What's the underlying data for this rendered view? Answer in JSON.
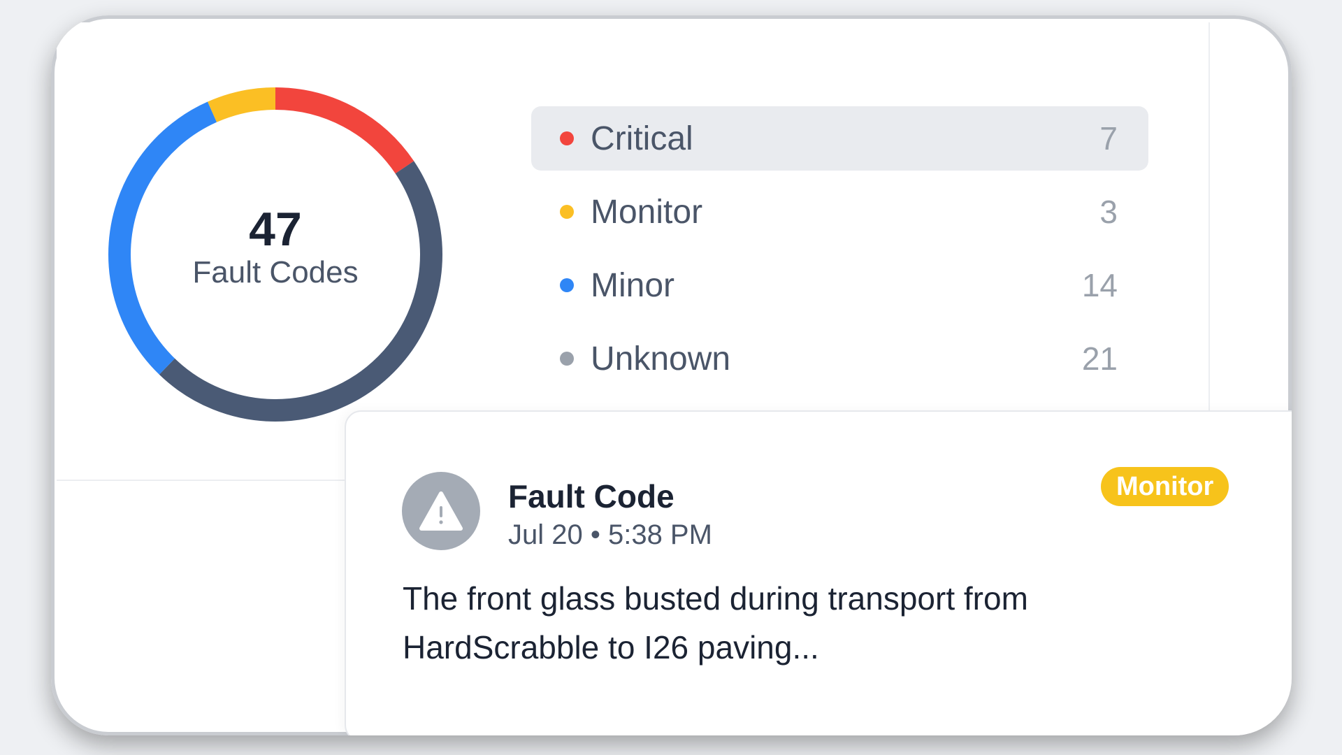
{
  "summary": {
    "total": "47",
    "total_label": "Fault Codes",
    "categories": [
      {
        "label": "Critical",
        "count": "7",
        "color": "#f2453d",
        "active": true
      },
      {
        "label": "Monitor",
        "count": "3",
        "color": "#fbbf24",
        "active": false
      },
      {
        "label": "Minor",
        "count": "14",
        "color": "#2f86f6",
        "active": false
      },
      {
        "label": "Unknown",
        "count": "21",
        "color": "#9aa1ab",
        "active": false
      }
    ],
    "donut_colors": {
      "critical": "#f2453d",
      "monitor": "#fbbf24",
      "minor": "#2f86f6",
      "unknown": "#4a5a75"
    }
  },
  "detail": {
    "icon": "warning-triangle-icon",
    "title": "Fault Code",
    "time": "Jul 20 • 5:38 PM",
    "badge": "Monitor",
    "badge_color": "#f7c31b",
    "body": "The front glass busted during transport from HardScrabble to I26 paving..."
  }
}
